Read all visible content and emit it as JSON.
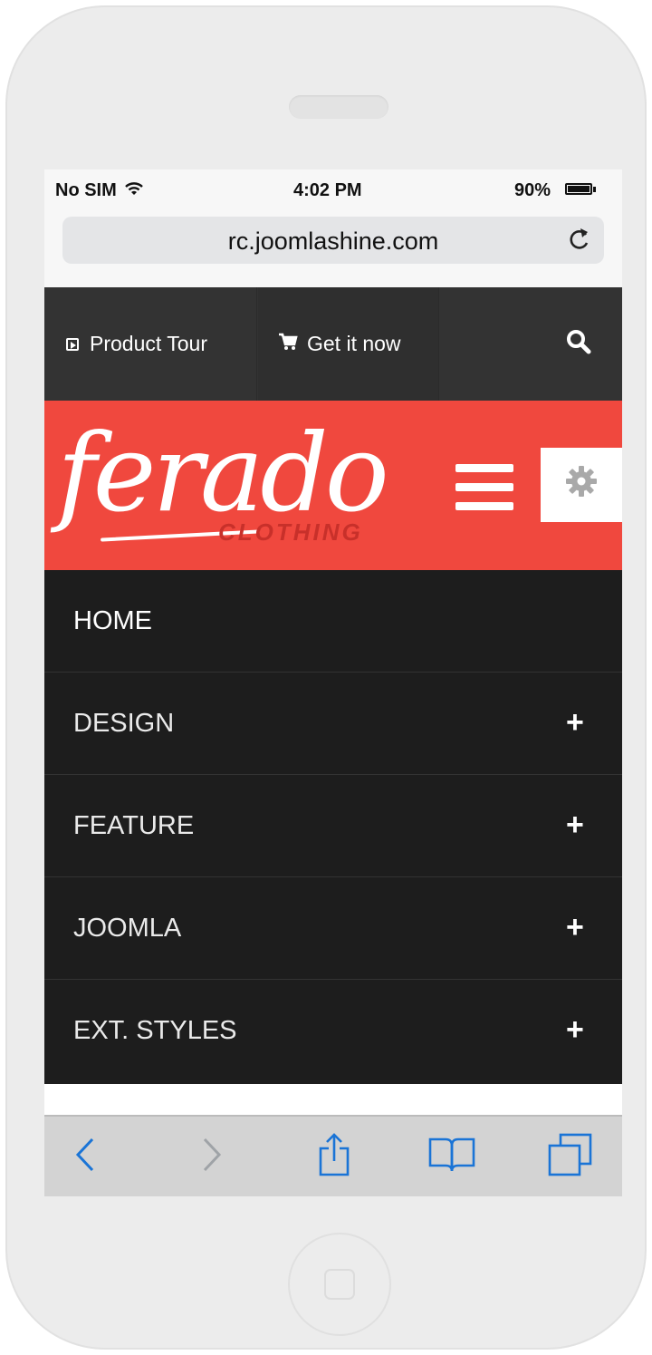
{
  "status_bar": {
    "carrier": "No SIM",
    "time": "4:02 PM",
    "battery": "90%"
  },
  "browser": {
    "url": "rc.joomlashine.com"
  },
  "top_nav": {
    "product_tour": "Product Tour",
    "get_it_now": "Get it now"
  },
  "brand": {
    "logo": "ferado",
    "tagline": "CLOTHING"
  },
  "menu": {
    "items": [
      {
        "label": "HOME",
        "expandable": false
      },
      {
        "label": "DESIGN",
        "expandable": true
      },
      {
        "label": "FEATURE",
        "expandable": true
      },
      {
        "label": "JOOMLA",
        "expandable": true
      },
      {
        "label": "EXT. STYLES",
        "expandable": true
      }
    ],
    "expand_glyph": "+"
  },
  "colors": {
    "brand_red": "#f0483e",
    "nav_dark": "#333333",
    "menu_dark": "#1d1d1d",
    "ios_blue": "#1a74d6"
  },
  "icons": {
    "wifi": "wifi-icon",
    "reload": "reload-icon",
    "product_tour": "play-icon",
    "get_it_now": "cart-icon",
    "search": "search-icon",
    "menu_toggle": "hamburger-icon",
    "settings": "gear-icon",
    "toolbar": [
      "back-icon",
      "forward-icon",
      "share-icon",
      "bookmarks-icon",
      "tabs-icon"
    ]
  }
}
